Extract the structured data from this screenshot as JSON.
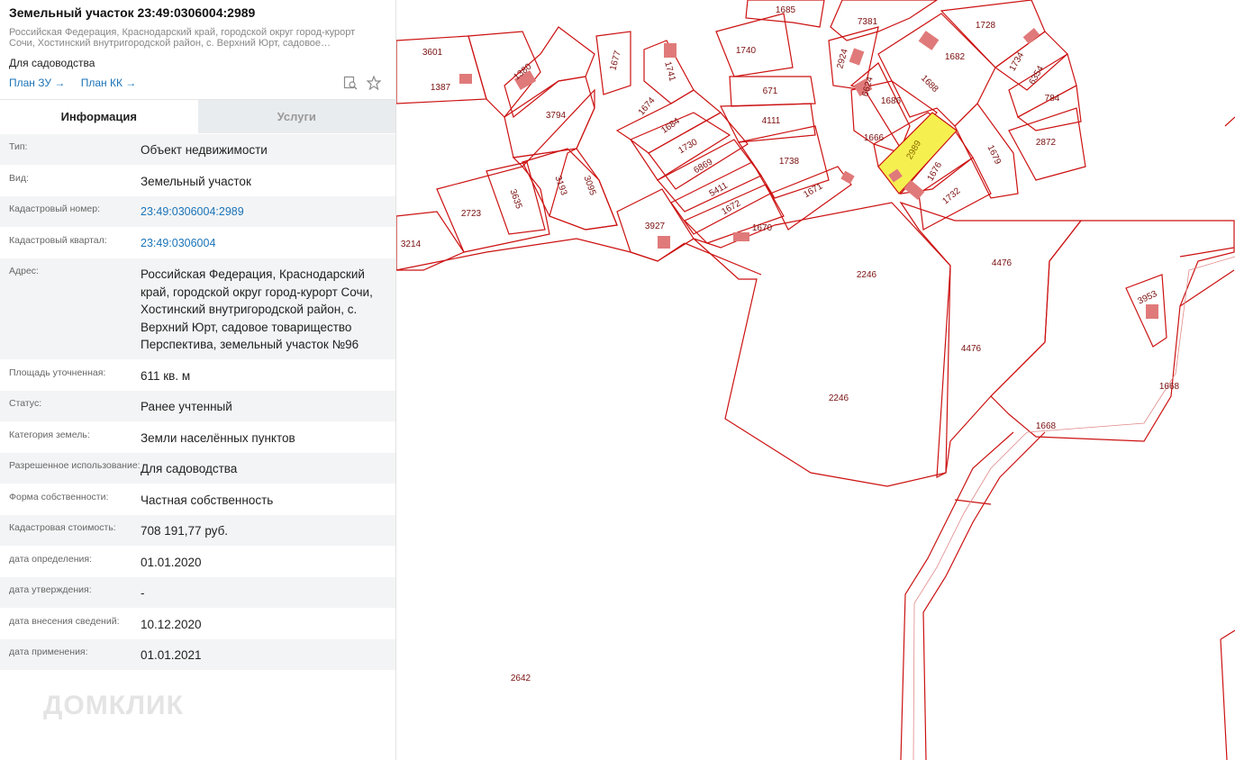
{
  "header": {
    "title": "Земельный участок 23:49:0306004:2989",
    "address_short_1": "Российская Федерация, Краснодарский край, городской округ город-курорт",
    "address_short_2": "Сочи, Хостинский внутригородской район, с. Верхний Юрт, садовое…",
    "purpose": "Для садоводства",
    "plan_zu": "План ЗУ →",
    "plan_kk": "План КК →"
  },
  "tabs": {
    "info": "Информация",
    "services": "Услуги"
  },
  "rows": [
    {
      "label": "Тип:",
      "value": "Объект недвижимости"
    },
    {
      "label": "Вид:",
      "value": "Земельный участок"
    },
    {
      "label": "Кадастровый номер:",
      "value": "23:49:0306004:2989"
    },
    {
      "label": "Кадастровый квартал:",
      "value": "23:49:0306004"
    },
    {
      "label": "Адрес:",
      "value": "Российская Федерация, Краснодарский край, городской округ город-курорт Сочи, Хостинский внутригородской район, с. Верхний Юрт, садовое товарищество Перспектива, земельный участок №96"
    },
    {
      "label": "Площадь уточненная:",
      "value": "611 кв. м"
    },
    {
      "label": "Статус:",
      "value": "Ранее учтенный"
    },
    {
      "label": "Категория земель:",
      "value": "Земли населённых пунктов"
    },
    {
      "label": "Разрешенное использование:",
      "value": "Для садоводства"
    },
    {
      "label": "Форма собственности:",
      "value": "Частная собственность"
    },
    {
      "label": "Кадастровая стоимость:",
      "value": "708 191,77 руб."
    },
    {
      "label": "дата определения:",
      "value": "01.01.2020"
    },
    {
      "label": "дата утверждения:",
      "value": "-"
    },
    {
      "label": "дата внесения сведений:",
      "value": "10.12.2020"
    },
    {
      "label": "дата применения:",
      "value": "01.01.2021"
    }
  ],
  "watermark": "ДОМКЛИК",
  "map": {
    "colors": {
      "boundary": "#cc1111",
      "building": "#e07a7a",
      "selected": "#f5f050",
      "label": "#7a1010"
    },
    "parcel_labels": [
      "1685",
      "7381",
      "1728",
      "3601",
      "1387",
      "1380",
      "1677",
      "1741",
      "1740",
      "2924",
      "6624",
      "1682",
      "1734",
      "6354",
      "784",
      "3794",
      "671",
      "1686",
      "1688",
      "1674",
      "1684",
      "4111",
      "1666",
      "2989",
      "2872",
      "1730",
      "6869",
      "1738",
      "1679",
      "5411",
      "1676",
      "1671",
      "1732",
      "3193",
      "3095",
      "3635",
      "2723",
      "1672",
      "1670",
      "3927",
      "3214",
      "2246",
      "4476",
      "3953",
      "1668",
      "2642"
    ],
    "selected_label": "2989"
  }
}
